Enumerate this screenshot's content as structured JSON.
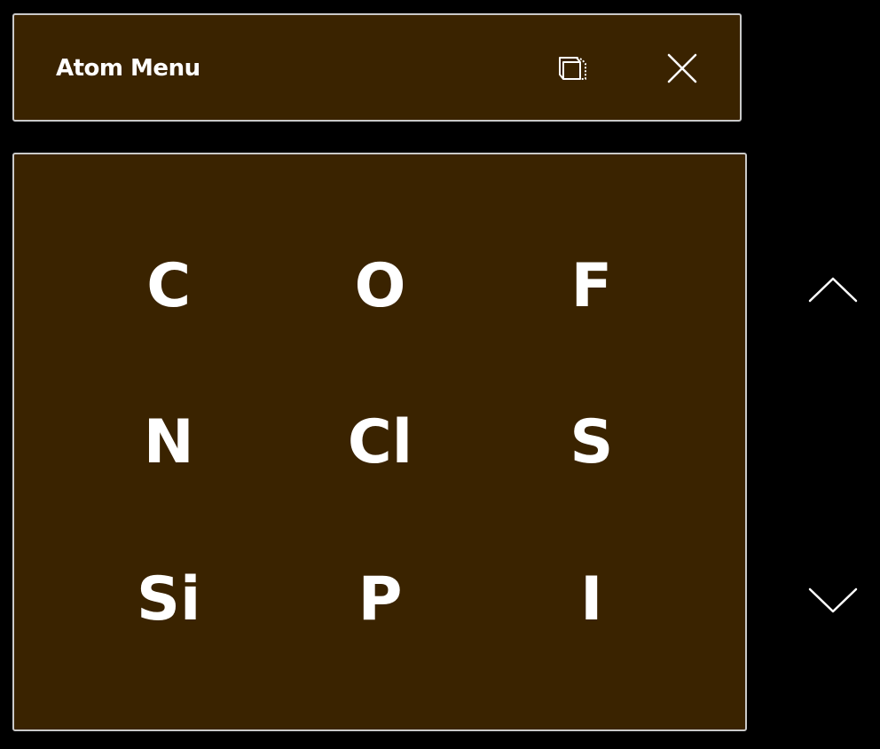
{
  "window": {
    "title": "Atom Menu",
    "pin_icon": "pin-window-icon",
    "close_icon": "close-icon"
  },
  "atoms": [
    {
      "symbol": "C"
    },
    {
      "symbol": "O"
    },
    {
      "symbol": "F"
    },
    {
      "symbol": "N"
    },
    {
      "symbol": "Cl"
    },
    {
      "symbol": "S"
    },
    {
      "symbol": "Si"
    },
    {
      "symbol": "P"
    },
    {
      "symbol": "I"
    }
  ],
  "navigation": {
    "up_icon": "chevron-up-icon",
    "down_icon": "chevron-down-icon"
  },
  "colors": {
    "panel_background": "#3a2300",
    "border": "#c9c9c9",
    "text": "#ffffff",
    "page_background": "#000000"
  }
}
